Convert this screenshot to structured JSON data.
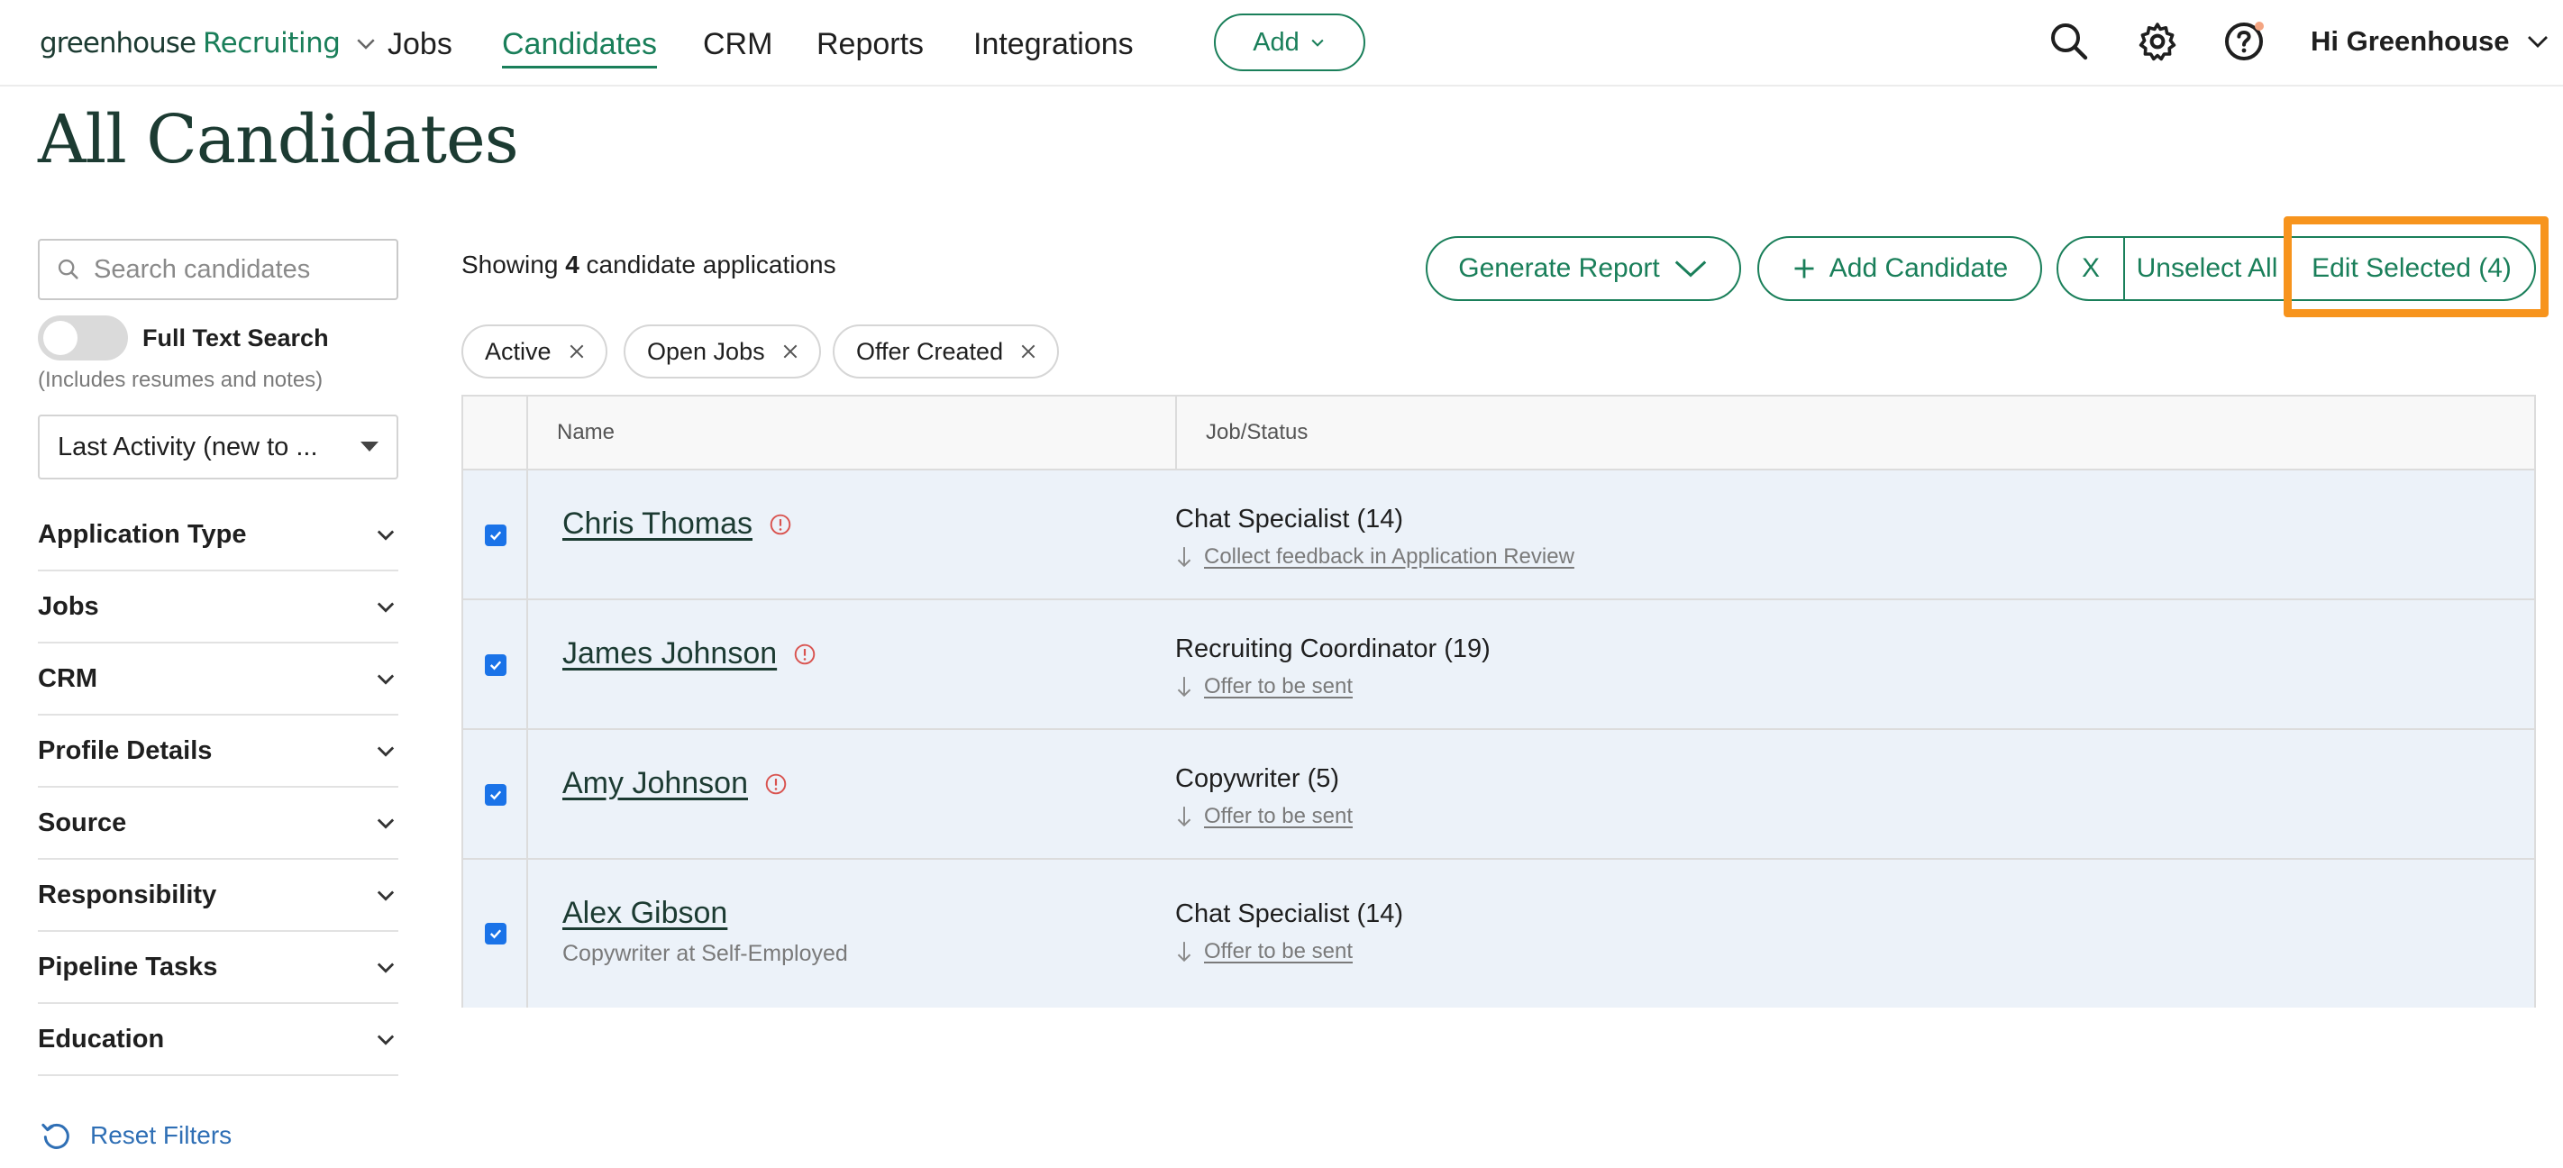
{
  "nav": {
    "logo_brand": "greenhouse",
    "logo_product": "Recruiting",
    "links": [
      "Jobs",
      "Candidates",
      "CRM",
      "Reports",
      "Integrations"
    ],
    "active_link": "Candidates",
    "add_label": "Add",
    "greeting": "Hi Greenhouse"
  },
  "page": {
    "title": "All Candidates"
  },
  "sidebar": {
    "search_placeholder": "Search candidates",
    "full_text_label": "Full Text Search",
    "full_text_sub": "(Includes resumes and notes)",
    "sort_value": "Last Activity (new to ...",
    "filters": [
      "Application Type",
      "Jobs",
      "CRM",
      "Profile Details",
      "Source",
      "Responsibility",
      "Pipeline Tasks",
      "Education"
    ],
    "reset_label": "Reset Filters"
  },
  "main": {
    "showing_prefix": "Showing ",
    "showing_count": "4",
    "showing_suffix": " candidate applications",
    "generate_report": "Generate Report",
    "add_candidate": "Add Candidate",
    "clear_x": "X",
    "unselect_all": "Unselect All",
    "edit_selected": "Edit Selected (4)",
    "chips": [
      "Active",
      "Open Jobs",
      "Offer Created"
    ]
  },
  "table": {
    "headers": {
      "name": "Name",
      "job_status": "Job/Status"
    },
    "rows": [
      {
        "name": "Chris Thomas",
        "subtitle": "",
        "warning": true,
        "job": "Chat Specialist (14)",
        "status": "Collect feedback in Application Review",
        "checked": true
      },
      {
        "name": "James Johnson",
        "subtitle": "",
        "warning": true,
        "job": "Recruiting Coordinator (19)",
        "status": "Offer to be sent",
        "checked": true
      },
      {
        "name": "Amy Johnson",
        "subtitle": "",
        "warning": true,
        "job": "Copywriter (5)",
        "status": "Offer to be sent",
        "checked": true
      },
      {
        "name": "Alex Gibson",
        "subtitle": "Copywriter at Self-Employed",
        "warning": false,
        "job": "Chat Specialist (14)",
        "status": "Offer to be sent",
        "checked": true
      }
    ]
  },
  "colors": {
    "accent": "#1a7f5a",
    "highlight": "#f7941d",
    "row_bg": "#ecf2f9",
    "link_blue": "#2f6fb5"
  }
}
